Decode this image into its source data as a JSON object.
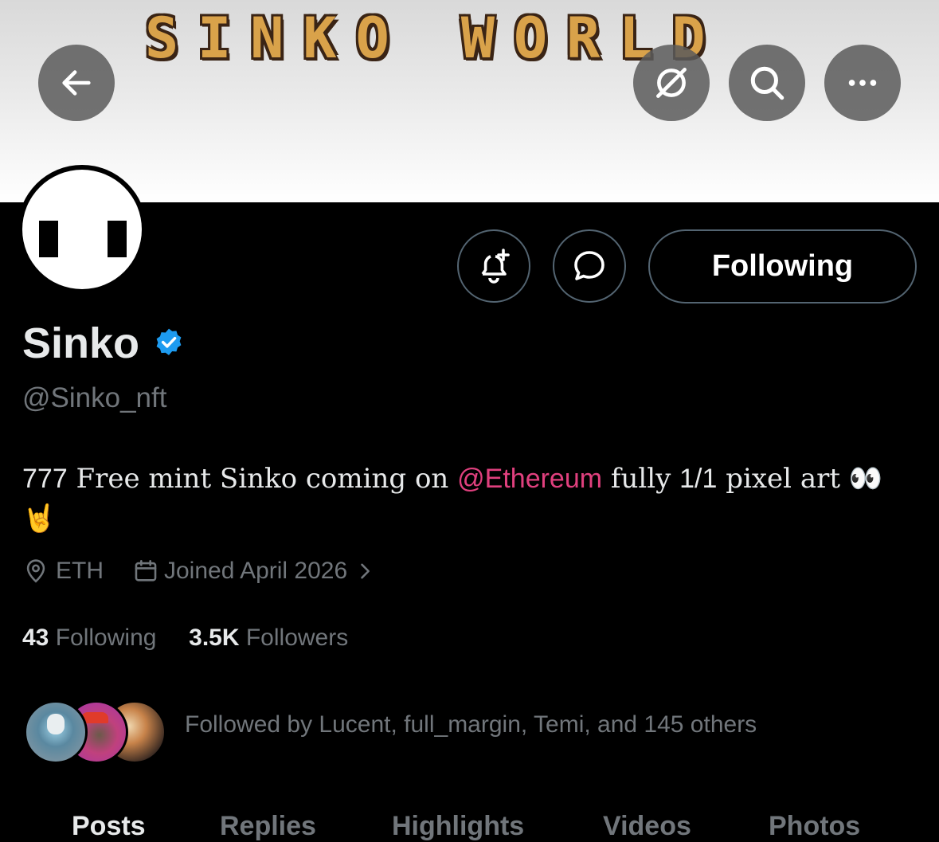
{
  "banner": {
    "title": "SINKO WORLD"
  },
  "header": {
    "back_icon": "arrow-left-icon",
    "grok_icon": "slash-circle-icon",
    "search_icon": "search-icon",
    "more_icon": "more-horizontal-icon"
  },
  "actions": {
    "notify_icon": "bell-plus-icon",
    "message_icon": "chat-bubble-icon",
    "follow_label": "Following"
  },
  "profile": {
    "name": "Sinko",
    "handle": "@Sinko_nft",
    "verified_color": "#1d9bf0",
    "bio_parts": {
      "p1": "777",
      "p2": " Free mint Sinko coming on ",
      "mention": "@Ethereum",
      "p3": " fully ",
      "p4": "1/1",
      "p5": " pixel art ",
      "emoji1": "👀",
      "emoji2": "🤘"
    },
    "location": "ETH",
    "joined": "Joined April 2026"
  },
  "stats": {
    "following_count": "43",
    "following_label": "Following",
    "followers_count": "3.5K",
    "followers_label": "Followers"
  },
  "followed_by": "Followed by Lucent, full_margin, Temi, and 145 others",
  "tabs": [
    "Posts",
    "Replies",
    "Highlights",
    "Videos",
    "Photos"
  ],
  "colors": {
    "mention": "#e0407e",
    "muted": "#71767b",
    "background": "#000000"
  }
}
